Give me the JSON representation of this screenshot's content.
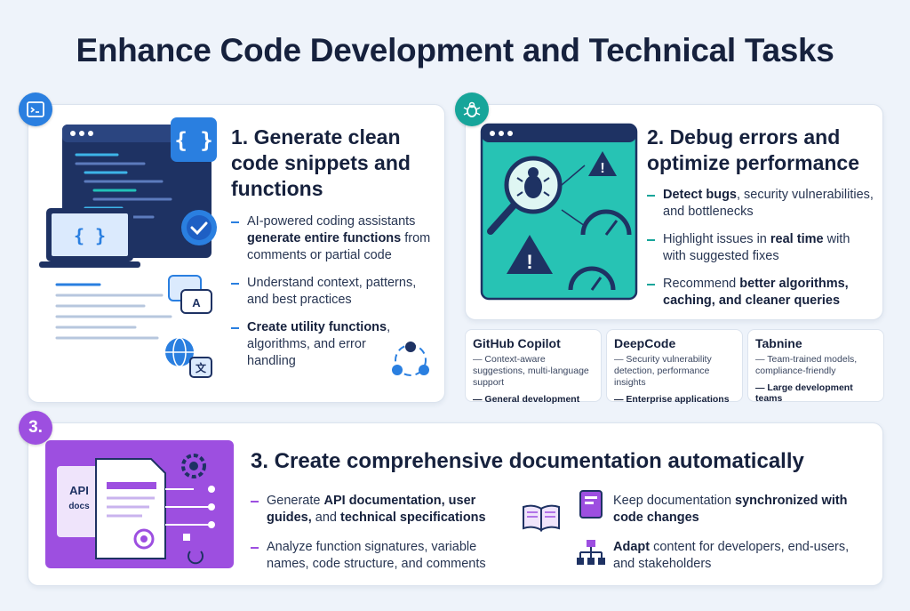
{
  "title": "Enhance Code Development and Technical Tasks",
  "section1": {
    "heading": "1. Generate clean code snippets and functions",
    "bullets": [
      {
        "pre": "AI-powered coding assistants ",
        "bold": "generate entire functions",
        "post": " from comments or partial code"
      },
      {
        "pre": "Understand context, patterns, and best practices",
        "bold": "",
        "post": ""
      },
      {
        "pre": "",
        "bold": "Create utility functions",
        "post": ", algorithms, and error handling"
      }
    ]
  },
  "section2": {
    "heading": "2. Debug errors and optimize performance",
    "bullets": [
      {
        "pre": "",
        "bold": "Detect bugs",
        "post": ", security vulnerabilities, and bottlenecks"
      },
      {
        "pre": "Highlight issues in ",
        "bold": "real time",
        "post": " with with suggested fixes"
      },
      {
        "pre": "Recommend ",
        "bold": "better algorithms, caching, and cleaner queries",
        "post": ""
      }
    ],
    "tools": [
      {
        "name": "GitHub Copilot",
        "desc": "— Context-aware suggestions, multi-language support",
        "use": "— General development"
      },
      {
        "name": "DeepCode",
        "desc": "— Security vulnerability detection, performance insights",
        "use": "— Enterprise applications"
      },
      {
        "name": "Tabnine",
        "desc": "— Team-trained models, compliance-friendly",
        "use": "— Large development teams"
      }
    ]
  },
  "section3": {
    "badge": "3.",
    "heading": "3. Create comprehensive documentation automatically",
    "doc_label_1": "API",
    "doc_label_2": "docs",
    "bullets_left": [
      {
        "pre": "Generate ",
        "bold": "API documentation, user guides,",
        "post": " and ",
        "bold2": "technical specifications"
      },
      {
        "pre": "Analyze function signatures, variable names, code structure, and comments",
        "bold": "",
        "post": "",
        "bold2": ""
      }
    ],
    "bullets_right": [
      {
        "pre": "Keep documentation ",
        "bold": "synchronized with code changes",
        "post": ""
      },
      {
        "pre": "",
        "bold": "Adapt",
        "post": " content for developers, end-users, and stakeholders"
      }
    ]
  },
  "colors": {
    "blue": "#2a7fe0",
    "teal": "#17a59a",
    "purple": "#9d4fe0",
    "navy": "#1e3263"
  }
}
